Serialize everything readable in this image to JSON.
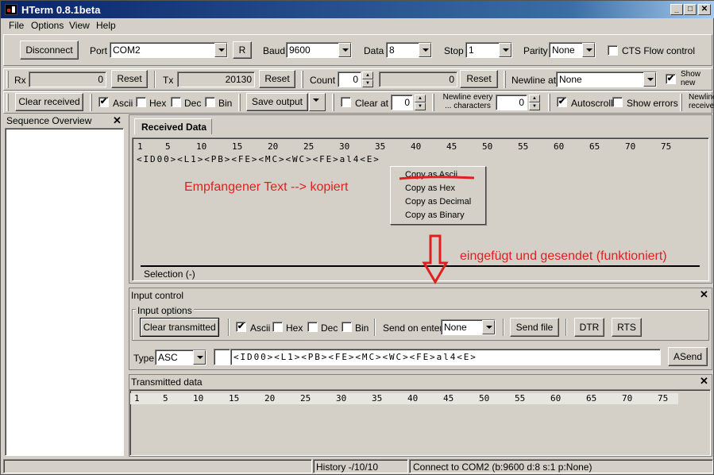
{
  "window": {
    "title": "HTerm 0.8.1beta"
  },
  "menu": [
    "File",
    "Options",
    "View",
    "Help"
  ],
  "toolbar1": {
    "disconnect": "Disconnect",
    "port_label": "Port",
    "port_value": "COM2",
    "r_button": "R",
    "baud_label": "Baud",
    "baud_value": "9600",
    "data_label": "Data",
    "data_value": "8",
    "stop_label": "Stop",
    "stop_value": "1",
    "parity_label": "Parity",
    "parity_value": "None",
    "cts_label": "CTS Flow control"
  },
  "toolbar2": {
    "rx_label": "Rx",
    "rx_value": "0",
    "rx_reset": "Reset",
    "tx_label": "Tx",
    "tx_value": "20130",
    "tx_reset": "Reset",
    "count_label": "Count",
    "count_value": "0",
    "count_total": "0",
    "count_reset": "Reset",
    "newline_label": "Newline at",
    "newline_value": "None",
    "show_newline_label": "Show new characters"
  },
  "toolbar3": {
    "clear_received": "Clear received",
    "ascii": "Ascii",
    "hex": "Hex",
    "dec": "Dec",
    "bin": "Bin",
    "save_output": "Save output",
    "clear_at": "Clear at",
    "clear_at_value": "0",
    "newline_every": "Newline every ... characters",
    "newline_every_value": "0",
    "autoscroll": "Autoscroll",
    "show_errors": "Show errors",
    "newline_receive": "Newline receive"
  },
  "sequence_panel": {
    "title": "Sequence Overview"
  },
  "received": {
    "tab": "Received Data",
    "ruler": [
      "1",
      "5",
      "10",
      "15",
      "20",
      "25",
      "30",
      "35",
      "40",
      "45",
      "50",
      "55",
      "60",
      "65",
      "70",
      "75"
    ],
    "data_line": "<ID00><L1><PB><FE><MC><WC><FE>al4<E>",
    "selection": "Selection (-)"
  },
  "context_menu": [
    "Copy as Ascii",
    "Copy as Hex",
    "Copy as Decimal",
    "Copy as Binary"
  ],
  "annotations": {
    "copied": "Empfangener Text --> kopiert",
    "sent": "eingefügt und gesendet (funktioniert)",
    "color": "#e02020"
  },
  "input_control": {
    "title": "Input control",
    "options_title": "Input options",
    "clear_transmitted": "Clear transmitted",
    "ascii": "Ascii",
    "hex": "Hex",
    "dec": "Dec",
    "bin": "Bin",
    "send_on_enter_label": "Send on enter",
    "send_on_enter_value": "None",
    "send_file": "Send file",
    "dtr": "DTR",
    "rts": "RTS",
    "type_label": "Type",
    "type_value": "ASC",
    "input_value": "<ID00><L1><PB><FE><MC><WC><FE>al4<E>",
    "asend": "ASend"
  },
  "transmitted": {
    "title": "Transmitted data",
    "ruler": [
      "1",
      "5",
      "10",
      "15",
      "20",
      "25",
      "30",
      "35",
      "40",
      "45",
      "50",
      "55",
      "60",
      "65",
      "70",
      "75"
    ]
  },
  "status": {
    "history": "History -/10/10",
    "connection": "Connect to COM2 (b:9600 d:8 s:1 p:None)"
  }
}
